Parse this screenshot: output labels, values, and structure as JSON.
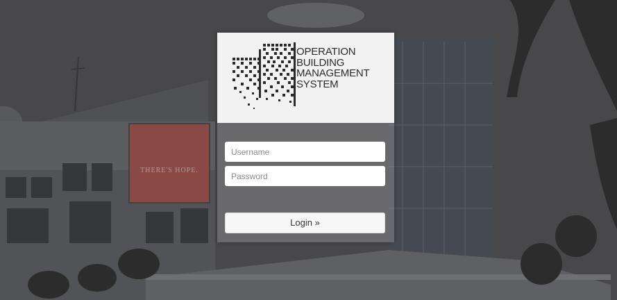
{
  "logo": {
    "lines": [
      "OPERATION",
      "BUILDING",
      "MANAGEMENT",
      "SYSTEM"
    ]
  },
  "form": {
    "username_placeholder": "Username",
    "password_placeholder": "Password",
    "login_label": "Login »"
  },
  "background": {
    "billboard_text": "THERE'S HOPE."
  },
  "colors": {
    "overlay": "#4a4a4e",
    "card_header": "#f2f2f2",
    "billboard": "#b2554f",
    "logo_text": "#2b2b2b"
  }
}
